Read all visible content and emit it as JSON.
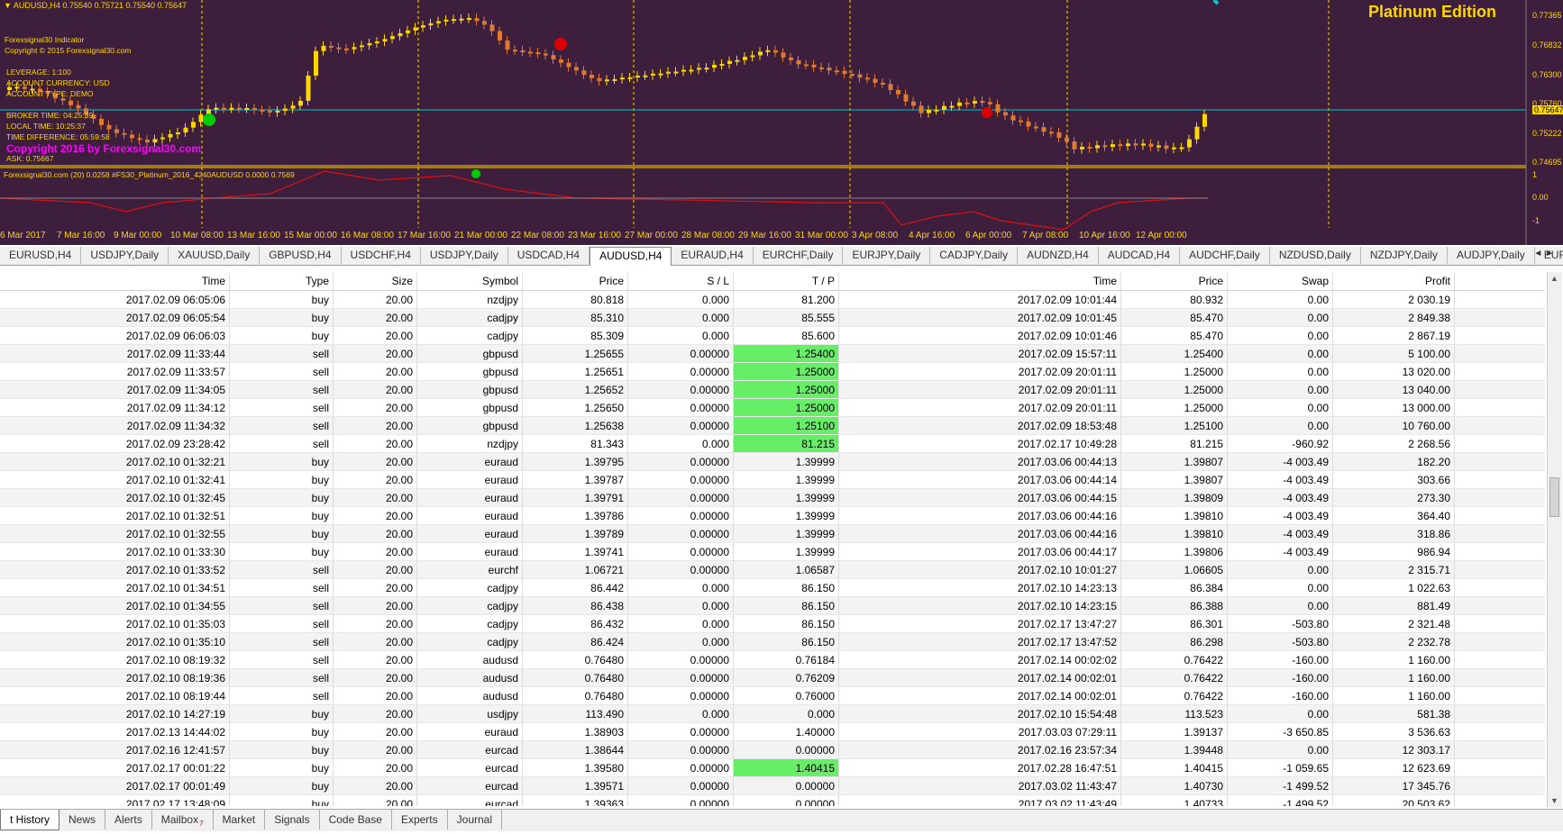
{
  "chart": {
    "header": "AUDUSD,H4  0.75540 0.75721 0.75540 0.75647",
    "edition": "Platinum Edition",
    "indicator_name": "Forexsignal30 Indicator",
    "copyright_2015": "Copyright © 2015 Forexsignal30.com",
    "leverage": "LEVERAGE:   1:100",
    "account_currency": "ACCOUNT CURRENCY:   USD",
    "account_type": "ACCOUNT TYPE:   DEMO",
    "broker_time": "BROKER TIME:   04:25:39",
    "local_time": "LOCAL TIME:   10:25:37",
    "time_difference": "TIME DIFFERENCE:   05:59:58",
    "ask": "ASK:   0.75667",
    "copyright_2016": "Copyright 2016 by Forexsignal30.com",
    "subwindow_label": "Forexsignal30.com (20) 0.0258  #FS30_Platinum_2016_4240AUDUSD 0.0000 0.7569",
    "price_labels": [
      "0.77365",
      "0.76832",
      "0.76300",
      "0.75760",
      "0.75647",
      "0.75222",
      "0.74695"
    ],
    "sub_labels": [
      "1",
      "0.00",
      "-1"
    ],
    "dates": [
      "6 Mar 2017",
      "7 Mar 16:00",
      "9 Mar 00:00",
      "10 Mar 08:00",
      "13 Mar 16:00",
      "15 Mar 00:00",
      "16 Mar 08:00",
      "17 Mar 16:00",
      "21 Mar 00:00",
      "22 Mar 08:00",
      "23 Mar 16:00",
      "27 Mar 00:00",
      "28 Mar 08:00",
      "29 Mar 16:00",
      "31 Mar 00:00",
      "3 Apr 08:00",
      "4 Apr 16:00",
      "6 Apr 00:00",
      "7 Apr 08:00",
      "10 Apr 16:00",
      "12 Apr 00:00"
    ],
    "colors": {
      "background": "#3d1f3d",
      "bull": "#ffd700",
      "bear": "#e07a30",
      "grid": "#ffd700",
      "bid_line": "#00c8c8"
    }
  },
  "chart_tabs": [
    "EURUSD,H4",
    "USDJPY,Daily",
    "XAUUSD,Daily",
    "GBPUSD,H4",
    "USDCHF,H4",
    "USDJPY,Daily",
    "USDCAD,H4",
    "AUDUSD,H4",
    "EURAUD,H4",
    "EURCHF,Daily",
    "EURJPY,Daily",
    "CADJPY,Daily",
    "AUDNZD,H4",
    "AUDCAD,H4",
    "AUDCHF,Daily",
    "NZDUSD,Daily",
    "NZDJPY,Daily",
    "AUDJPY,Daily",
    "EURCAD,Daily"
  ],
  "active_chart_tab": "AUDUSD,H4",
  "chart_tab_nav": "◄ ►",
  "table": {
    "columns": [
      "Time",
      "Type",
      "Size",
      "Symbol",
      "Price",
      "S / L",
      "T / P",
      "Time",
      "Price",
      "Swap",
      "Profit"
    ],
    "rows": [
      [
        "2017.02.09 06:05:06",
        "buy",
        "20.00",
        "nzdjpy",
        "80.818",
        "0.000",
        "81.200",
        "2017.02.09 10:01:44",
        "80.932",
        "0.00",
        "2 030.19"
      ],
      [
        "2017.02.09 06:05:54",
        "buy",
        "20.00",
        "cadjpy",
        "85.310",
        "0.000",
        "85.555",
        "2017.02.09 10:01:45",
        "85.470",
        "0.00",
        "2 849.38"
      ],
      [
        "2017.02.09 06:06:03",
        "buy",
        "20.00",
        "cadjpy",
        "85.309",
        "0.000",
        "85.600",
        "2017.02.09 10:01:46",
        "85.470",
        "0.00",
        "2 867.19"
      ],
      [
        "2017.02.09 11:33:44",
        "sell",
        "20.00",
        "gbpusd",
        "1.25655",
        "0.00000",
        "1.25400",
        "2017.02.09 15:57:11",
        "1.25400",
        "0.00",
        "5 100.00"
      ],
      [
        "2017.02.09 11:33:57",
        "sell",
        "20.00",
        "gbpusd",
        "1.25651",
        "0.00000",
        "1.25000",
        "2017.02.09 20:01:11",
        "1.25000",
        "0.00",
        "13 020.00"
      ],
      [
        "2017.02.09 11:34:05",
        "sell",
        "20.00",
        "gbpusd",
        "1.25652",
        "0.00000",
        "1.25000",
        "2017.02.09 20:01:11",
        "1.25000",
        "0.00",
        "13 040.00"
      ],
      [
        "2017.02.09 11:34:12",
        "sell",
        "20.00",
        "gbpusd",
        "1.25650",
        "0.00000",
        "1.25000",
        "2017.02.09 20:01:11",
        "1.25000",
        "0.00",
        "13 000.00"
      ],
      [
        "2017.02.09 11:34:32",
        "sell",
        "20.00",
        "gbpusd",
        "1.25638",
        "0.00000",
        "1.25100",
        "2017.02.09 18:53:48",
        "1.25100",
        "0.00",
        "10 760.00"
      ],
      [
        "2017.02.09 23:28:42",
        "sell",
        "20.00",
        "nzdjpy",
        "81.343",
        "0.000",
        "81.215",
        "2017.02.17 10:49:28",
        "81.215",
        "-960.92",
        "2 268.56"
      ],
      [
        "2017.02.10 01:32:21",
        "buy",
        "20.00",
        "euraud",
        "1.39795",
        "0.00000",
        "1.39999",
        "2017.03.06 00:44:13",
        "1.39807",
        "-4 003.49",
        "182.20"
      ],
      [
        "2017.02.10 01:32:41",
        "buy",
        "20.00",
        "euraud",
        "1.39787",
        "0.00000",
        "1.39999",
        "2017.03.06 00:44:14",
        "1.39807",
        "-4 003.49",
        "303.66"
      ],
      [
        "2017.02.10 01:32:45",
        "buy",
        "20.00",
        "euraud",
        "1.39791",
        "0.00000",
        "1.39999",
        "2017.03.06 00:44:15",
        "1.39809",
        "-4 003.49",
        "273.30"
      ],
      [
        "2017.02.10 01:32:51",
        "buy",
        "20.00",
        "euraud",
        "1.39786",
        "0.00000",
        "1.39999",
        "2017.03.06 00:44:16",
        "1.39810",
        "-4 003.49",
        "364.40"
      ],
      [
        "2017.02.10 01:32:55",
        "buy",
        "20.00",
        "euraud",
        "1.39789",
        "0.00000",
        "1.39999",
        "2017.03.06 00:44:16",
        "1.39810",
        "-4 003.49",
        "318.86"
      ],
      [
        "2017.02.10 01:33:30",
        "buy",
        "20.00",
        "euraud",
        "1.39741",
        "0.00000",
        "1.39999",
        "2017.03.06 00:44:17",
        "1.39806",
        "-4 003.49",
        "986.94"
      ],
      [
        "2017.02.10 01:33:52",
        "sell",
        "20.00",
        "eurchf",
        "1.06721",
        "0.00000",
        "1.06587",
        "2017.02.10 10:01:27",
        "1.06605",
        "0.00",
        "2 315.71"
      ],
      [
        "2017.02.10 01:34:51",
        "sell",
        "20.00",
        "cadjpy",
        "86.442",
        "0.000",
        "86.150",
        "2017.02.10 14:23:13",
        "86.384",
        "0.00",
        "1 022.63"
      ],
      [
        "2017.02.10 01:34:55",
        "sell",
        "20.00",
        "cadjpy",
        "86.438",
        "0.000",
        "86.150",
        "2017.02.10 14:23:15",
        "86.388",
        "0.00",
        "881.49"
      ],
      [
        "2017.02.10 01:35:03",
        "sell",
        "20.00",
        "cadjpy",
        "86.432",
        "0.000",
        "86.150",
        "2017.02.17 13:47:27",
        "86.301",
        "-503.80",
        "2 321.48"
      ],
      [
        "2017.02.10 01:35:10",
        "sell",
        "20.00",
        "cadjpy",
        "86.424",
        "0.000",
        "86.150",
        "2017.02.17 13:47:52",
        "86.298",
        "-503.80",
        "2 232.78"
      ],
      [
        "2017.02.10 08:19:32",
        "sell",
        "20.00",
        "audusd",
        "0.76480",
        "0.00000",
        "0.76184",
        "2017.02.14 00:02:02",
        "0.76422",
        "-160.00",
        "1 160.00"
      ],
      [
        "2017.02.10 08:19:36",
        "sell",
        "20.00",
        "audusd",
        "0.76480",
        "0.00000",
        "0.76209",
        "2017.02.14 00:02:01",
        "0.76422",
        "-160.00",
        "1 160.00"
      ],
      [
        "2017.02.10 08:19:44",
        "sell",
        "20.00",
        "audusd",
        "0.76480",
        "0.00000",
        "0.76000",
        "2017.02.14 00:02:01",
        "0.76422",
        "-160.00",
        "1 160.00"
      ],
      [
        "2017.02.10 14:27:19",
        "buy",
        "20.00",
        "usdjpy",
        "113.490",
        "0.000",
        "0.000",
        "2017.02.10 15:54:48",
        "113.523",
        "0.00",
        "581.38"
      ],
      [
        "2017.02.13 14:44:02",
        "buy",
        "20.00",
        "euraud",
        "1.38903",
        "0.00000",
        "1.40000",
        "2017.03.03 07:29:11",
        "1.39137",
        "-3 650.85",
        "3 536.63"
      ],
      [
        "2017.02.16 12:41:57",
        "buy",
        "20.00",
        "eurcad",
        "1.38644",
        "0.00000",
        "0.00000",
        "2017.02.16 23:57:34",
        "1.39448",
        "0.00",
        "12 303.17"
      ],
      [
        "2017.02.17 00:01:22",
        "buy",
        "20.00",
        "eurcad",
        "1.39580",
        "0.00000",
        "1.40415",
        "2017.02.28 16:47:51",
        "1.40415",
        "-1 059.65",
        "12 623.69"
      ],
      [
        "2017.02.17 00:01:49",
        "buy",
        "20.00",
        "eurcad",
        "1.39571",
        "0.00000",
        "0.00000",
        "2017.03.02 11:43:47",
        "1.40730",
        "-1 499.52",
        "17 345.76"
      ],
      [
        "2017.02.17 13:48:09",
        "buy",
        "20.00",
        "eurcad",
        "1.39363",
        "0.00000",
        "0.00000",
        "2017.03.02 11:43:49",
        "1.40733",
        "-1 499.52",
        "20 503.62"
      ]
    ],
    "highlight_tp_rows": [
      3,
      4,
      5,
      6,
      7,
      8,
      26
    ],
    "highlight_color": "#66ee66"
  },
  "scroll": {
    "up": "▲",
    "down": "▼"
  },
  "bottom_tabs": [
    {
      "label": "t History",
      "active": true
    },
    {
      "label": "News"
    },
    {
      "label": "Alerts"
    },
    {
      "label": "Mailbox",
      "badge": "7"
    },
    {
      "label": "Market"
    },
    {
      "label": "Signals"
    },
    {
      "label": "Code Base"
    },
    {
      "label": "Experts"
    },
    {
      "label": "Journal"
    }
  ]
}
